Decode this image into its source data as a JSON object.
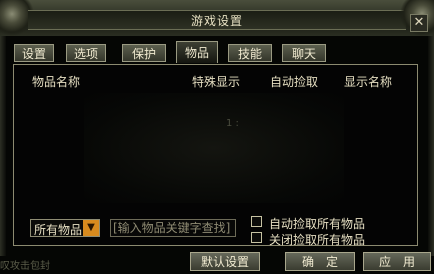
{
  "window": {
    "title": "游戏设置"
  },
  "tabs": [
    {
      "label": "设置",
      "active": false
    },
    {
      "label": "选项",
      "active": false
    },
    {
      "label": "保护",
      "active": false
    },
    {
      "label": "物品",
      "active": true
    },
    {
      "label": "技能",
      "active": false
    },
    {
      "label": "聊天",
      "active": false
    }
  ],
  "list": {
    "columns": [
      "物品名称",
      "特殊显示",
      "自动捡取",
      "显示名称"
    ],
    "center_mark": "1 :"
  },
  "filter": {
    "selected": "所有物品",
    "search_placeholder": "[输入物品关键字查找]"
  },
  "options": {
    "auto_pickup_all": "自动捡取所有物品",
    "close_pickup_all": "关闭捡取所有物品"
  },
  "buttons": {
    "default": "默认设置",
    "ok": "确　定",
    "apply": "应　用"
  },
  "background_hint": "叹攻击包封",
  "colors": {
    "accent": "#d78a1e",
    "border": "#8c8a70",
    "text": "#e6dfc2"
  }
}
